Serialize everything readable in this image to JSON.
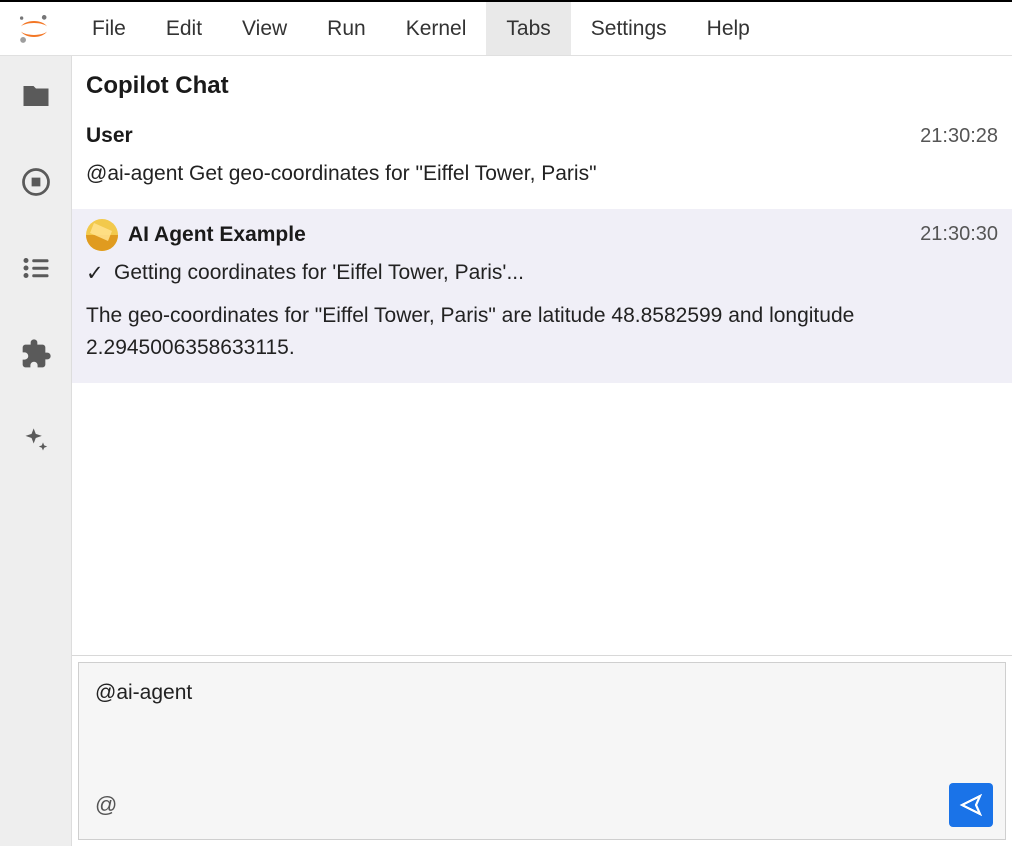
{
  "menubar": {
    "items": [
      "File",
      "Edit",
      "View",
      "Run",
      "Kernel",
      "Tabs",
      "Settings",
      "Help"
    ],
    "active_index": 5
  },
  "panel": {
    "title": "Copilot Chat"
  },
  "messages": {
    "user": {
      "sender": "User",
      "time": "21:30:28",
      "body": "@ai-agent Get geo-coordinates for \"Eiffel Tower, Paris\""
    },
    "agent": {
      "sender": "AI Agent Example",
      "time": "21:30:30",
      "status_check": "✓",
      "status_text": "Getting coordinates for 'Eiffel Tower, Paris'...",
      "body": "The geo-coordinates for \"Eiffel Tower, Paris\" are latitude 48.8582599 and longitude 2.2945006358633115."
    }
  },
  "composer": {
    "value": "@ai-agent",
    "at_symbol": "@"
  }
}
